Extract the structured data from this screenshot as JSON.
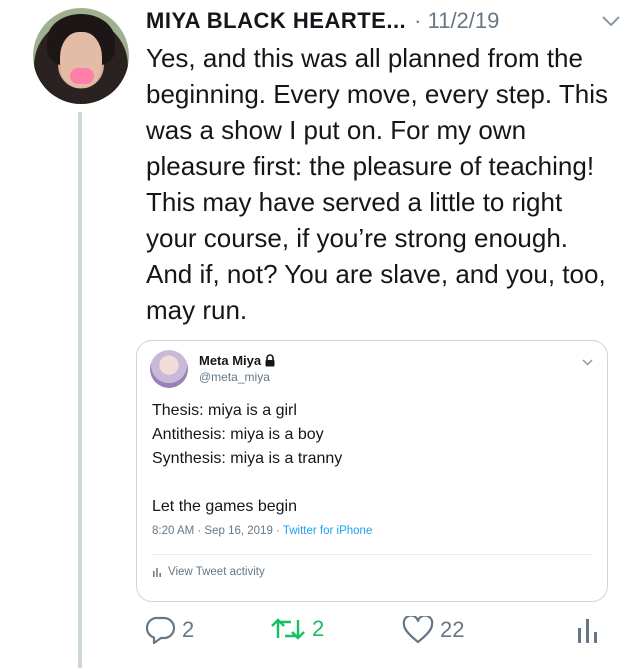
{
  "tweet": {
    "author_name": "MIYA BLACK HEARTE...",
    "date": "· 11/2/19",
    "text": "Yes, and this was all planned from the beginning. Every move, every step. This was a show I put on. For my own pleasure first: the pleasure of teaching! This may have served a little to right your course, if you’re strong enough. And if, not? You are slave, and you, too, may run."
  },
  "quoted_tweet": {
    "author_name": "Meta Miya",
    "handle": "@meta_miya",
    "lines": [
      "Thesis: miya is a girl",
      "Antithesis: miya is a boy",
      "Synthesis: miya is a tranny",
      "",
      "Let the games begin"
    ],
    "timestamp": "8:20 AM · Sep 16, 2019 · ",
    "source": "Twitter for iPhone",
    "activity_label": "View Tweet activity"
  },
  "actions": {
    "reply_count": "2",
    "retweet_count": "2",
    "like_count": "22"
  },
  "colors": {
    "text": "#14171a",
    "secondary": "#657786",
    "retweet_active": "#17bf63",
    "link": "#1da1f2",
    "border": "#ccd6dd"
  },
  "icons": [
    "avatar",
    "chevron-down-icon",
    "lock-icon",
    "stats-icon",
    "reply-icon",
    "retweet-icon",
    "like-icon",
    "analytics-icon"
  ]
}
